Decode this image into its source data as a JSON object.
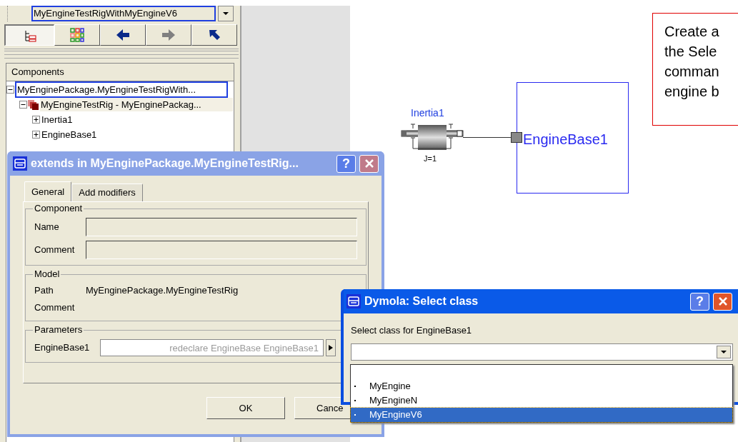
{
  "browser_panel": {
    "class_combo": {
      "value": "MyEngineTestRigWithMyEngineV6"
    },
    "toolbar": [
      {
        "kind": "tree",
        "selected": true,
        "disabled": false
      },
      {
        "kind": "grid",
        "selected": false,
        "disabled": false
      },
      {
        "kind": "back",
        "selected": false,
        "disabled": false
      },
      {
        "kind": "forward",
        "selected": false,
        "disabled": true
      },
      {
        "kind": "up",
        "selected": false,
        "disabled": false
      }
    ],
    "components": {
      "header": "Components",
      "tree": [
        {
          "label": "MyEnginePackage.MyEngineTestRigWith...",
          "expanded": true,
          "selected": true,
          "children": [
            {
              "label": "MyEngineTestRig - MyEnginePackag...",
              "expanded": true,
              "selected": false,
              "children": [
                {
                  "label": "Inertia1",
                  "expanded": false,
                  "selected": false
                },
                {
                  "label": "EngineBase1",
                  "expanded": false,
                  "selected": false
                }
              ]
            }
          ]
        }
      ]
    }
  },
  "diagram": {
    "inertia": {
      "name": "Inertia1",
      "parameter": "J=1"
    },
    "engine_base": {
      "name": "EngineBase1"
    }
  },
  "callout": {
    "lines": [
      "Create a",
      "the Sele",
      "comman",
      "engine b"
    ]
  },
  "extends_dialog": {
    "title": "extends in MyEnginePackage.MyEngineTestRig...",
    "help_button": "?",
    "tabs": [
      {
        "label": "General",
        "selected": true
      },
      {
        "label": "Add modifiers",
        "selected": false
      }
    ],
    "component_group": {
      "title": "Component",
      "fields": [
        {
          "label": "Name"
        },
        {
          "label": "Comment"
        }
      ]
    },
    "model_group": {
      "title": "Model",
      "rows": [
        {
          "label": "Path",
          "value": "MyEnginePackage.MyEngineTestRig"
        },
        {
          "label": "Comment"
        }
      ]
    },
    "parameters_group": {
      "title": "Parameters",
      "rows": [
        {
          "label": "EngineBase1",
          "placeholder": "redeclare EngineBase EngineBase1"
        }
      ]
    },
    "buttons": [
      "OK",
      "Cance"
    ]
  },
  "select_dialog": {
    "title": "Dymola: Select class",
    "help_button": "?",
    "prompt": "Select class for EngineBase1",
    "options": [
      {
        "label": "MyEngine",
        "selected": false
      },
      {
        "label": "MyEngineN",
        "selected": false
      },
      {
        "label": "MyEngineV6",
        "selected": true
      }
    ]
  }
}
